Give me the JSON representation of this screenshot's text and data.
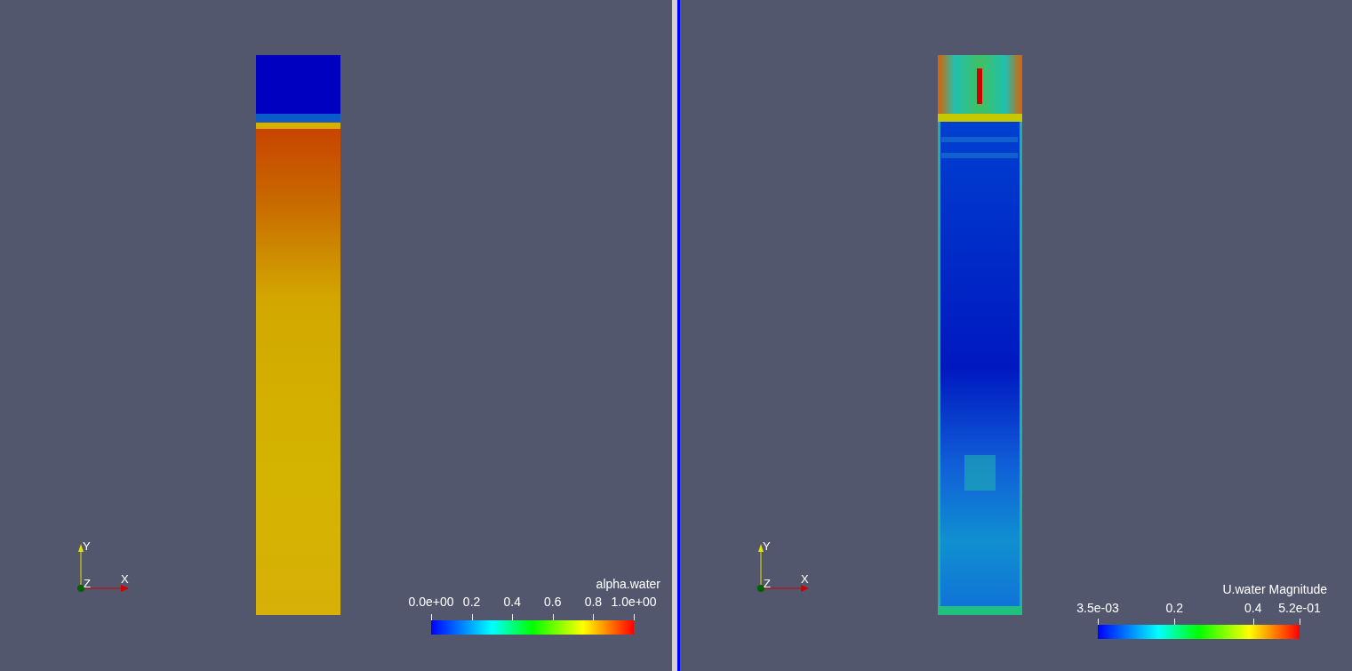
{
  "views": [
    {
      "selected": false,
      "kind": "volume-fraction",
      "axes": {
        "x": "X",
        "y": "Y",
        "z": "Z"
      },
      "color_legend": {
        "title": "alpha.water",
        "tick_labels": [
          "0.0e+00",
          "0.2",
          "0.4",
          "0.6",
          "0.8",
          "1.0e+00"
        ]
      }
    },
    {
      "selected": true,
      "kind": "velocity",
      "axes": {
        "x": "X",
        "y": "Y",
        "z": "Z"
      },
      "color_legend": {
        "title": "U.water Magnitude",
        "tick_labels": [
          "3.5e-03",
          "0.2",
          "0.4",
          "5.2e-01"
        ]
      }
    }
  ]
}
